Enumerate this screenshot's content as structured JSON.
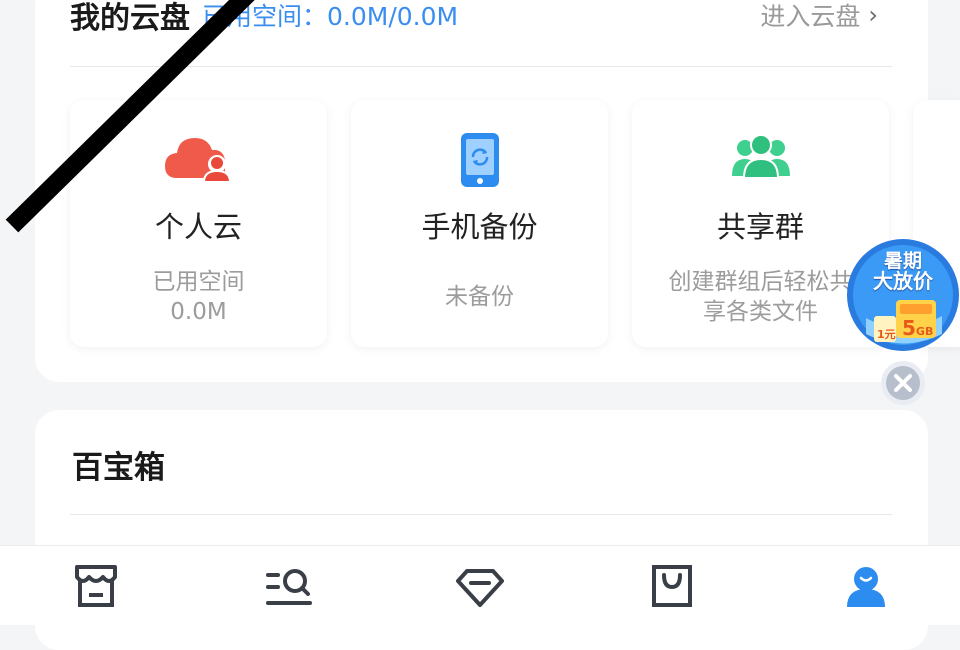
{
  "cloud": {
    "title": "我的云盘",
    "usage": "已用空间：0.0M/0.0M",
    "enter_label": "进入云盘",
    "tiles": [
      {
        "title": "个人云",
        "sub_line1": "已用空间",
        "sub_line2": "0.0M",
        "icon": "cloud-user-icon"
      },
      {
        "title": "手机备份",
        "sub_line1": "未备份",
        "icon": "phone-sync-icon"
      },
      {
        "title": "共享群",
        "sub_line1": "创建群组后轻松共",
        "sub_line2": "享各类文件",
        "icon": "group-icon"
      }
    ]
  },
  "toolbox": {
    "title": "百宝箱"
  },
  "promo": {
    "line1": "暑期",
    "line2": "大放价",
    "badge": "5",
    "badge_unit": "GB",
    "small": "1元"
  },
  "tabbar": {
    "items": [
      {
        "icon": "store-icon"
      },
      {
        "icon": "search-list-icon"
      },
      {
        "icon": "diamond-icon"
      },
      {
        "icon": "bag-icon"
      },
      {
        "icon": "profile-icon",
        "active": true
      }
    ]
  },
  "colors": {
    "accent": "#3a8ef0",
    "cloud_red": "#f05a4a",
    "green": "#3fcf8e",
    "active_tab": "#2d8cf0"
  }
}
